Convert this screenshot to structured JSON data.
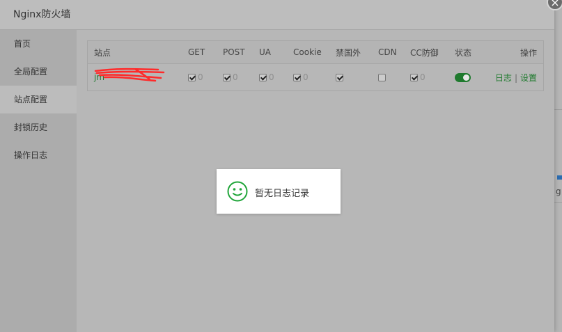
{
  "window": {
    "title": "Nginx防火墙",
    "close_symbol": "×"
  },
  "sidebar": {
    "items": [
      {
        "label": "首页"
      },
      {
        "label": "全局配置"
      },
      {
        "label": "站点配置",
        "active": true
      },
      {
        "label": "封锁历史"
      },
      {
        "label": "操作日志"
      }
    ]
  },
  "table": {
    "headers": [
      "站点",
      "GET",
      "POST",
      "UA",
      "Cookie",
      "禁国外",
      "CDN",
      "CC防御",
      "状态",
      "操作"
    ],
    "rows": [
      {
        "site": "jm",
        "get": {
          "checked": true,
          "count": "0"
        },
        "post": {
          "checked": true,
          "count": "0"
        },
        "ua": {
          "checked": true,
          "count": "0"
        },
        "cookie": {
          "checked": true,
          "count": "0"
        },
        "block_foreign": {
          "checked": true
        },
        "cdn": {
          "checked": false
        },
        "cc": {
          "checked": true,
          "count": "0"
        },
        "status": "on",
        "actions": {
          "log": "日志",
          "separator": "|",
          "settings": "设置"
        }
      }
    ]
  },
  "toast": {
    "message": "暂无日志记录",
    "icon": "smile-icon"
  },
  "background": {
    "partial_char": "g"
  },
  "colors": {
    "accent": "#1f7a2e",
    "redaction": "#ff2a2a",
    "toast_icon": "#20a53a"
  }
}
